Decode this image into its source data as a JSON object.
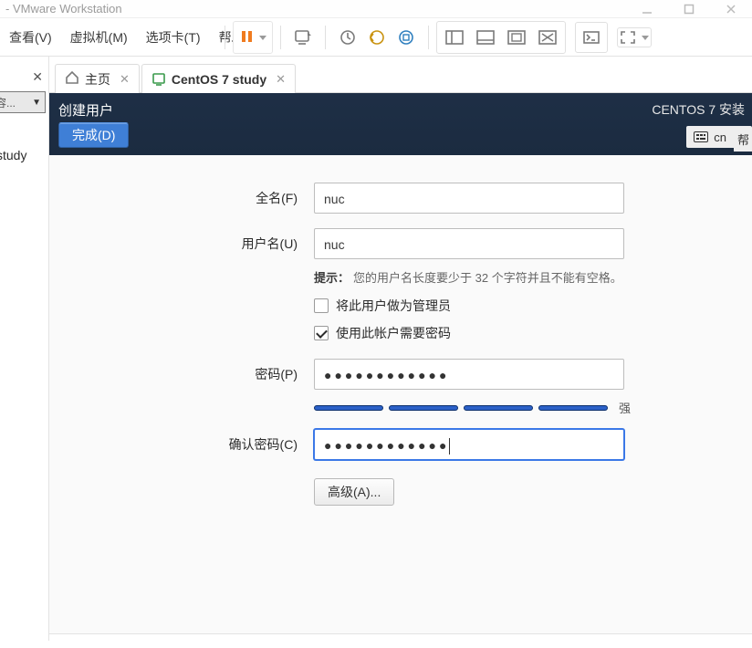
{
  "window": {
    "title": "- VMware Workstation"
  },
  "menu": {
    "view": "查看(V)",
    "vm": "虚拟机(M)",
    "tabs": "选项卡(T)",
    "help": "帮助(H)"
  },
  "tabs": {
    "home": "主页",
    "vm": "CentOS 7 study"
  },
  "sidebar": {
    "partial_label": "study",
    "combo_placeholder": "容..."
  },
  "installer": {
    "title": "创建用户",
    "done": "完成(D)",
    "product": "CENTOS 7 安装",
    "lang": "cn",
    "help_cut": "帮"
  },
  "form": {
    "fullname_label": "全名(F)",
    "fullname_value": "nuc",
    "username_label": "用户名(U)",
    "username_value": "nuc",
    "hint_prefix": "提示：",
    "hint_text": "您的用户名长度要少于 32 个字符并且不能有空格。",
    "admin_label": "将此用户做为管理员",
    "require_pw_label": "使用此帐户需要密码",
    "password_label": "密码(P)",
    "password_dots": "●●●●●●●●●●●●",
    "confirm_label": "确认密码(C)",
    "confirm_dots": "●●●●●●●●●●●●",
    "strength_label": "强",
    "advanced_label": "高级(A)..."
  }
}
